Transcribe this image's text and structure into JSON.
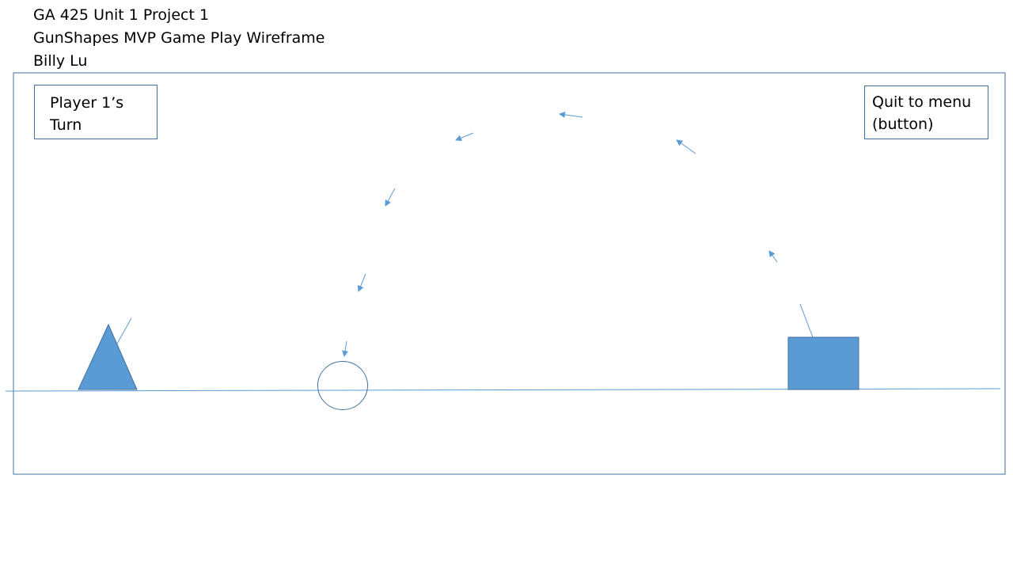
{
  "header": {
    "line1": "GA 425 Unit 1 Project 1",
    "line2": "GunShapes MVP Game Play Wireframe",
    "line3": "Billy Lu"
  },
  "turn_indicator": {
    "line1": "Player 1’s",
    "line2": "Turn"
  },
  "quit_button": {
    "line1": "Quit to menu",
    "line2": "(button)"
  },
  "colors": {
    "frame": "#41719c",
    "shape_fill": "#5b9bd5",
    "arrow": "#5b9bd5",
    "ground": "#5b9bd5"
  }
}
